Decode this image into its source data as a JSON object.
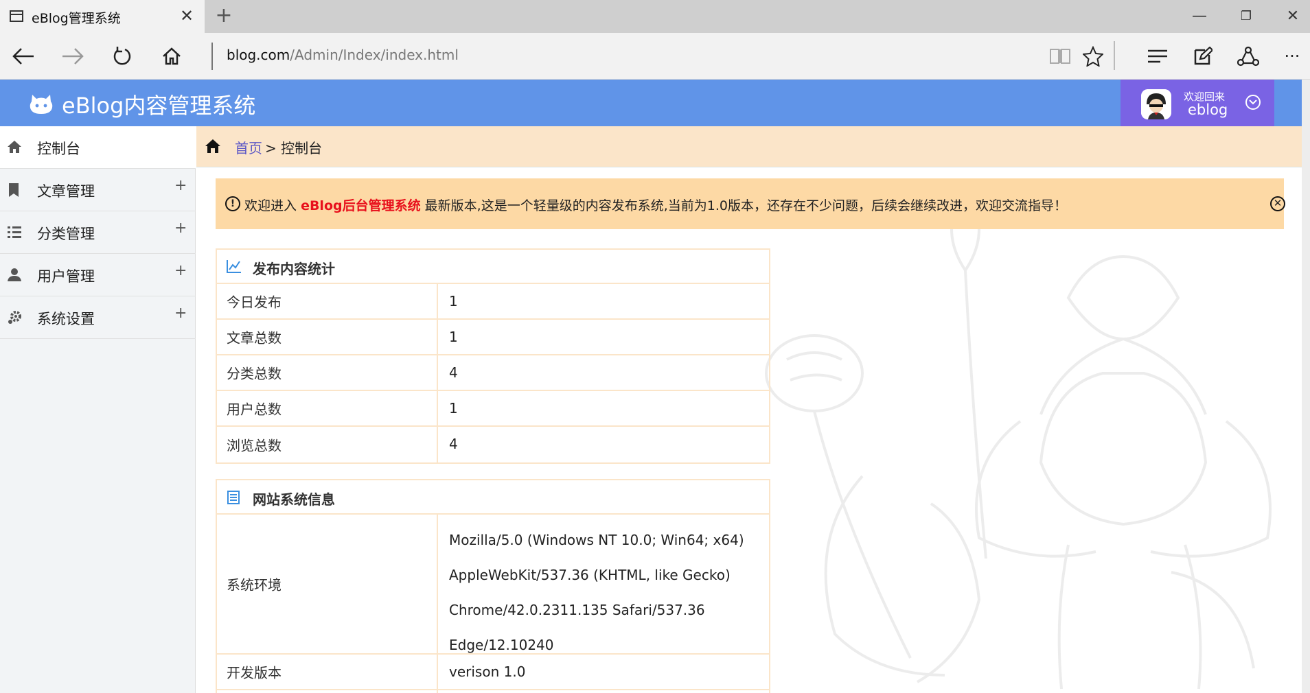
{
  "browser": {
    "tab_title": "eBlog管理系统",
    "url_host": "blog.com",
    "url_path": "/Admin/Index/index.html"
  },
  "header": {
    "app_title": "eBlog内容管理系统",
    "welcome": "欢迎回来",
    "username": "eblog"
  },
  "sidebar": {
    "items": [
      {
        "label": "控制台",
        "icon": "home-icon",
        "active": true
      },
      {
        "label": "文章管理",
        "icon": "bookmark-icon"
      },
      {
        "label": "分类管理",
        "icon": "list-icon"
      },
      {
        "label": "用户管理",
        "icon": "user-icon"
      },
      {
        "label": "系统设置",
        "icon": "gear-icon"
      }
    ]
  },
  "breadcrumb": {
    "home": "首页",
    "separator": " > ",
    "current": "控制台"
  },
  "alert": {
    "prefix": "欢迎进入",
    "brand": "eBlog后台管理系统",
    "suffix": "最新版本,这是一个轻量级的内容发布系统,当前为1.0版本，还存在不少问题，后续会继续改进，欢迎交流指导！"
  },
  "stats": {
    "title": "发布内容统计",
    "rows": [
      {
        "label": "今日发布",
        "value": "1"
      },
      {
        "label": "文章总数",
        "value": "1"
      },
      {
        "label": "分类总数",
        "value": "4"
      },
      {
        "label": "用户总数",
        "value": "1"
      },
      {
        "label": "浏览总数",
        "value": "4"
      }
    ]
  },
  "sysinfo": {
    "title": "网站系统信息",
    "env_label": "系统环境",
    "env_lines": [
      "Mozilla/5.0 (Windows NT 10.0; Win64; x64)",
      "AppleWebKit/537.36 (KHTML, like Gecko)",
      "Chrome/42.0.2311.135 Safari/537.36",
      "Edge/12.10240"
    ],
    "version_label": "开发版本",
    "version_value": "verison 1.0"
  },
  "colors": {
    "header_bg": "#6094e8",
    "user_box_bg": "#7a63e4",
    "breadcrumb_bg": "#fbe5c9",
    "alert_bg": "#fdd9a5",
    "brand_red": "#e8101c",
    "link_purple": "#5b57c6"
  }
}
